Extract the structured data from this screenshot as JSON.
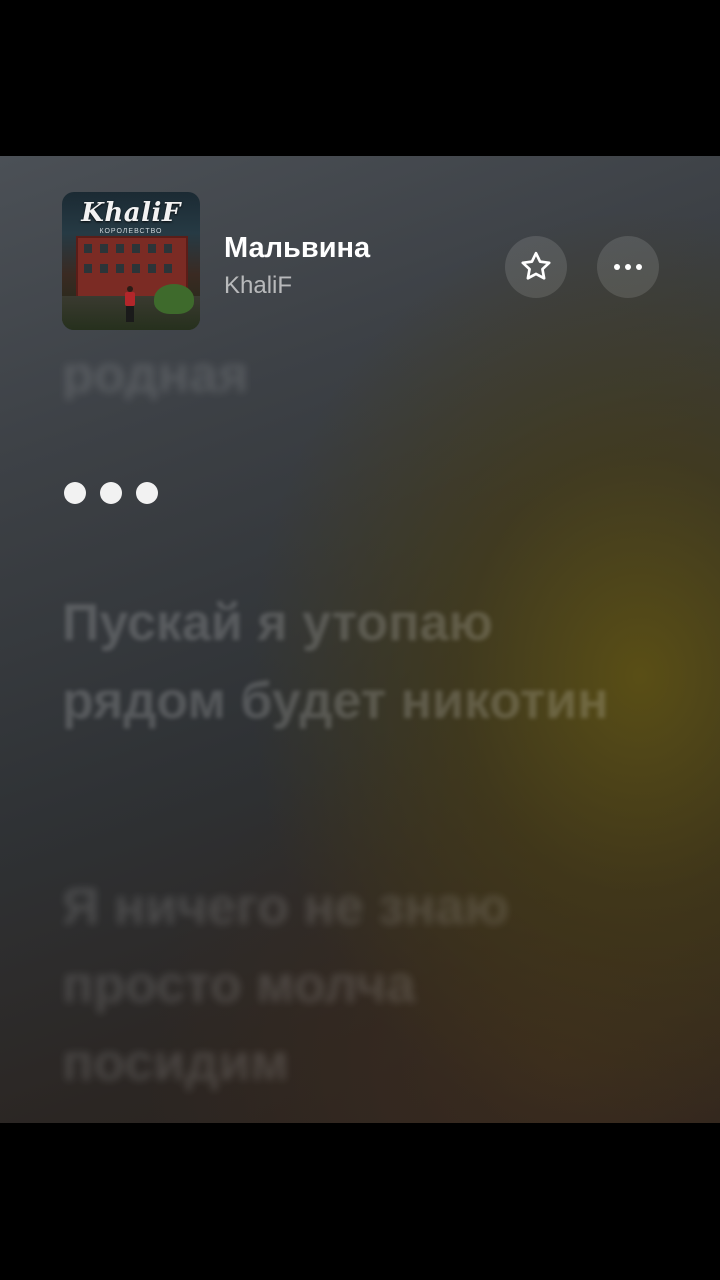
{
  "now_playing": {
    "title": "Мальвина",
    "artist": "KhaliF",
    "album_art": {
      "logo_text": "KhaliF",
      "subtitle_text": "КОРОЛЕВСТВО"
    }
  },
  "actions": {
    "favorite_icon": "star-outline-icon",
    "more_icon": "ellipsis-icon"
  },
  "lyrics": {
    "previous_line": "родная",
    "instrumental_indicator": "three-dots",
    "upcoming_lines": [
      "Пускай я утопаю рядом будет никотин",
      "Я ничего не знаю просто молча посидим"
    ]
  },
  "colors": {
    "accent_warm": "#5c5014",
    "text_primary": "#ffffff"
  }
}
